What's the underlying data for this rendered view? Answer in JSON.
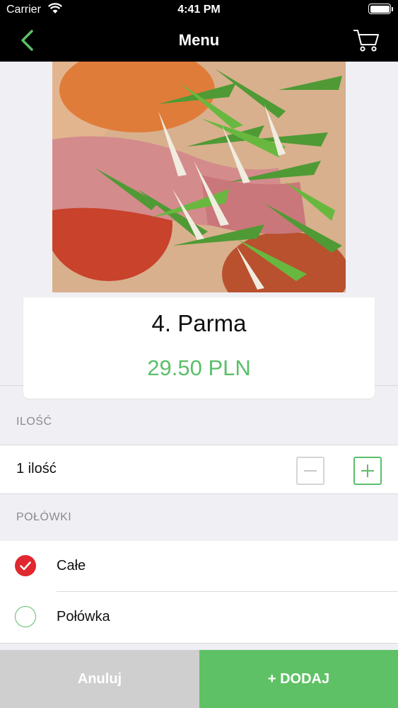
{
  "status_bar": {
    "carrier": "Carrier",
    "time": "4:41 PM"
  },
  "nav": {
    "title": "Menu",
    "back_icon": "chevron-left-icon",
    "cart_icon": "cart-icon"
  },
  "product": {
    "name": "4. Parma",
    "price": "29.50 PLN"
  },
  "quantity_section": {
    "header": "ILOŚĆ",
    "value_label": "1 ilość"
  },
  "halves_section": {
    "header": "POŁÓWKI",
    "options": [
      {
        "label": "Całe",
        "selected": true
      },
      {
        "label": "Połówka",
        "selected": false
      }
    ]
  },
  "buttons": {
    "cancel": "Anuluj",
    "add": "+ DODAJ"
  },
  "colors": {
    "accent": "#5bbf69",
    "selected_radio": "#e0282e",
    "cancel_bg": "#cfcfd0",
    "add_bg": "#5fc165"
  }
}
